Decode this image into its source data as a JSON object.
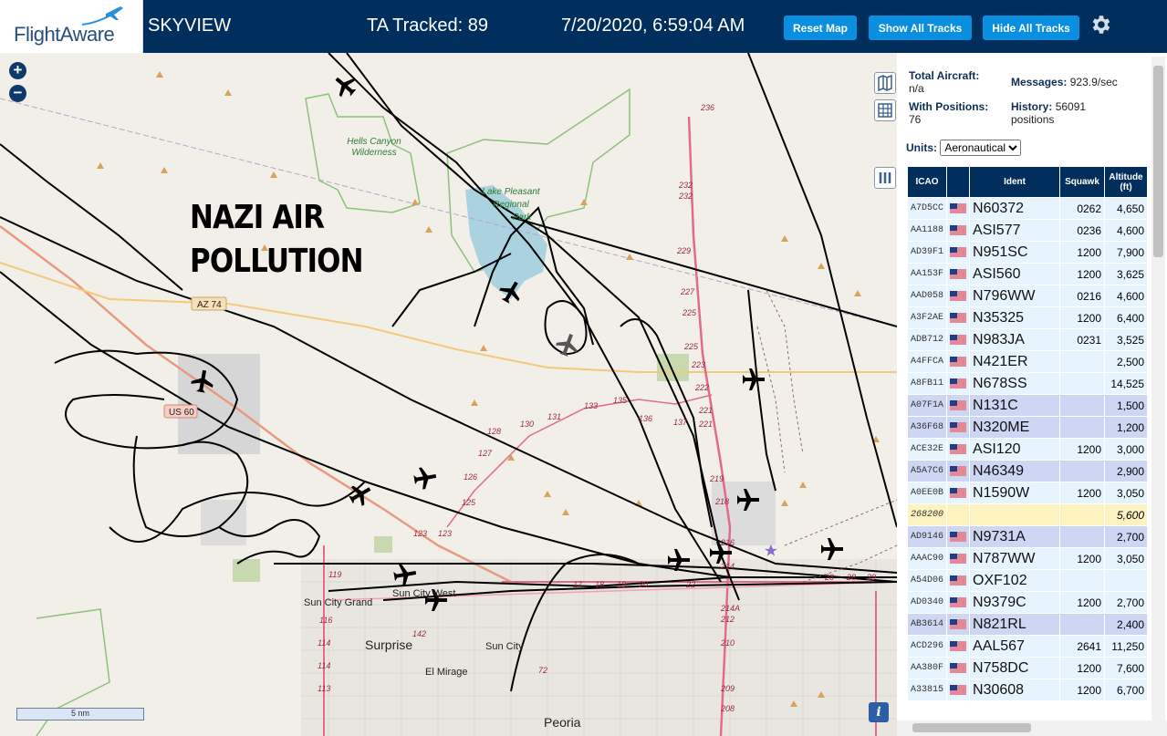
{
  "header": {
    "logo_text": "FlightAware",
    "app_name": "SKYVIEW",
    "tracked": "TA Tracked: 89",
    "datetime": "7/20/2020, 6:59:04 AM",
    "reset_map": "Reset Map",
    "show_all": "Show All Tracks",
    "hide_all": "Hide All Tracks",
    "settings_icon": "gear-icon"
  },
  "map": {
    "overlay_line1": "NAZI AIR",
    "overlay_line2": "POLLUTION",
    "zoom_in": "+",
    "zoom_out": "−",
    "scale": "5 nm",
    "info": "i",
    "labels": {
      "hells_canyon": "Hells Canyon",
      "wilderness": "Wilderness",
      "lake_pleasant": "Lake Pleasant",
      "regional": "Regional",
      "park": "Park",
      "az74": "AZ 74",
      "us60": "US 60",
      "sun_city_grand": "Sun City Grand",
      "sun_city_west": "Sun City West",
      "surprise": "Surprise",
      "sun_city": "Sun City",
      "el_mirage": "El Mirage",
      "peoria": "Peoria"
    },
    "route_numbers": [
      "236",
      "232",
      "232",
      "229",
      "227",
      "225",
      "225",
      "223",
      "222",
      "221",
      "221",
      "219",
      "218",
      "216",
      "214",
      "214A",
      "212",
      "210",
      "209",
      "208",
      "131",
      "130",
      "128",
      "127",
      "126",
      "125",
      "123",
      "123",
      "119",
      "116",
      "114",
      "114",
      "113",
      "142",
      "72",
      "17",
      "18",
      "19",
      "20",
      "22",
      "28",
      "28",
      "29",
      "135",
      "133",
      "136",
      "137"
    ]
  },
  "stats": {
    "total_label": "Total Aircraft:",
    "total_value": "n/a",
    "messages_label": "Messages:",
    "messages_value": "923.9/sec",
    "positions_label": "With Positions:",
    "positions_value": "76",
    "history_label": "History:",
    "history_value": "56091",
    "history_unit": "positions",
    "units_label": "Units:",
    "units_selected": "Aeronautical"
  },
  "table": {
    "headers": {
      "icao": "ICAO",
      "flag": "",
      "ident": "Ident",
      "squawk": "Squawk",
      "alt1": "Altitude",
      "alt2": "(ft)"
    },
    "rows": [
      {
        "icao": "A7D5CC",
        "ident": "N60372",
        "squawk": "0262",
        "alt": "4,650",
        "style": "even",
        "flag": true
      },
      {
        "icao": "AA1188",
        "ident": "ASI577",
        "squawk": "0236",
        "alt": "4,600",
        "style": "even",
        "flag": true
      },
      {
        "icao": "AD39F1",
        "ident": "N951SC",
        "squawk": "1200",
        "alt": "7,900",
        "style": "even",
        "flag": true
      },
      {
        "icao": "AA153F",
        "ident": "ASI560",
        "squawk": "1200",
        "alt": "3,625",
        "style": "even",
        "flag": true
      },
      {
        "icao": "AAD058",
        "ident": "N796WW",
        "squawk": "0216",
        "alt": "4,600",
        "style": "even",
        "flag": true
      },
      {
        "icao": "A3F2AE",
        "ident": "N35325",
        "squawk": "1200",
        "alt": "6,400",
        "style": "even",
        "flag": true
      },
      {
        "icao": "ADB712",
        "ident": "N983JA",
        "squawk": "0231",
        "alt": "3,525",
        "style": "even",
        "flag": true
      },
      {
        "icao": "A4FFCA",
        "ident": "N421ER",
        "squawk": "",
        "alt": "2,500",
        "style": "even",
        "flag": true
      },
      {
        "icao": "A8FB11",
        "ident": "N678SS",
        "squawk": "",
        "alt": "14,525",
        "style": "even",
        "flag": true
      },
      {
        "icao": "A07F1A",
        "ident": "N131C",
        "squawk": "",
        "alt": "1,500",
        "style": "blue",
        "flag": true
      },
      {
        "icao": "A36F68",
        "ident": "N320ME",
        "squawk": "",
        "alt": "1,200",
        "style": "blue",
        "flag": true
      },
      {
        "icao": "ACE32E",
        "ident": "ASI120",
        "squawk": "1200",
        "alt": "3,000",
        "style": "even",
        "flag": true
      },
      {
        "icao": "A5A7C6",
        "ident": "N46349",
        "squawk": "",
        "alt": "2,900",
        "style": "blue",
        "flag": true
      },
      {
        "icao": "A0EE0B",
        "ident": "N1590W",
        "squawk": "1200",
        "alt": "3,050",
        "style": "even",
        "flag": true
      },
      {
        "icao": "268200",
        "ident": "",
        "squawk": "",
        "alt": "5,600",
        "style": "yellow",
        "flag": false
      },
      {
        "icao": "AD9146",
        "ident": "N9731A",
        "squawk": "",
        "alt": "2,700",
        "style": "blue",
        "flag": true
      },
      {
        "icao": "AAAC90",
        "ident": "N787WW",
        "squawk": "1200",
        "alt": "3,050",
        "style": "even",
        "flag": true
      },
      {
        "icao": "A54D06",
        "ident": "OXF102",
        "squawk": "",
        "alt": "",
        "style": "even",
        "flag": true
      },
      {
        "icao": "AD0340",
        "ident": "N9379C",
        "squawk": "1200",
        "alt": "2,700",
        "style": "even",
        "flag": true
      },
      {
        "icao": "AB3614",
        "ident": "N821RL",
        "squawk": "",
        "alt": "2,400",
        "style": "blue",
        "flag": true
      },
      {
        "icao": "ACD296",
        "ident": "AAL567",
        "squawk": "2641",
        "alt": "11,250",
        "style": "even",
        "flag": true
      },
      {
        "icao": "AA380F",
        "ident": "N758DC",
        "squawk": "1200",
        "alt": "7,600",
        "style": "even",
        "flag": true
      },
      {
        "icao": "A33815",
        "ident": "N30608",
        "squawk": "1200",
        "alt": "6,700",
        "style": "even",
        "flag": true
      }
    ]
  },
  "colors": {
    "header_bg": "#002f5d",
    "button_bg": "#0a8fe0",
    "row_even": "#e6f4fd",
    "row_blue": "#cdd7f4",
    "row_yellow": "#fdf3c0"
  }
}
